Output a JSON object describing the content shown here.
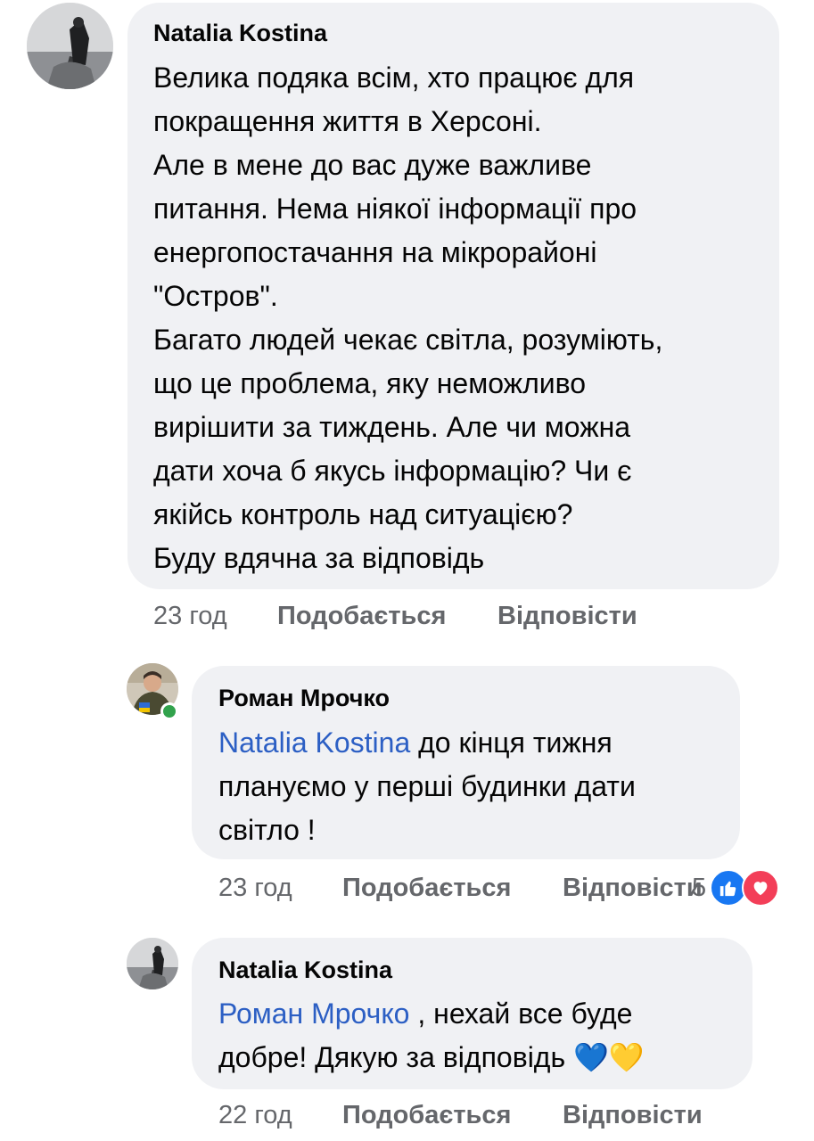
{
  "colors": {
    "bubble": "#f0f1f4",
    "mention": "#2c5fc4",
    "meta": "#65676b",
    "like": "#1877f2",
    "love": "#f33e58",
    "online": "#31a24c"
  },
  "comments": [
    {
      "author": "Natalia Kostina",
      "lines": [
        "Велика подяка всім, хто працює для",
        "покращення життя в Херсоні.",
        "Але в мене до вас дуже важливе",
        "питання. Нема ніякої інформації про",
        "енергопостачання на мікрорайоні",
        "\"Остров\".",
        "Багато людей чекає світла, розуміють,",
        "що це проблема, яку неможливо",
        "вирішити за тиждень. Але чи можна",
        "дати хоча б якусь інформацію? Чи є",
        "якійсь контроль над ситуацією?",
        "Буду вдячна за відповідь"
      ],
      "time": "23 год",
      "like_label": "Подобається",
      "reply_label": "Відповісти"
    },
    {
      "author": "Роман Мрочко",
      "mention": "Natalia Kostina",
      "line1_rest": " до кінця тижня",
      "lines": [
        "плануємо у перші будинки дати",
        "світло !"
      ],
      "time": "23 год",
      "like_label": "Подобається",
      "reply_label": "Відповісти",
      "reaction_count": "5",
      "reactions": [
        "like-icon",
        "love-icon"
      ]
    },
    {
      "author": "Natalia Kostina",
      "mention": "Роман Мрочко",
      "line1_rest": " , нехай все буде",
      "line2": "добре! Дякую за відповідь ",
      "emoji": [
        "💙",
        "💛"
      ],
      "time": "22 год",
      "like_label": "Подобається",
      "reply_label": "Відповісти"
    }
  ]
}
